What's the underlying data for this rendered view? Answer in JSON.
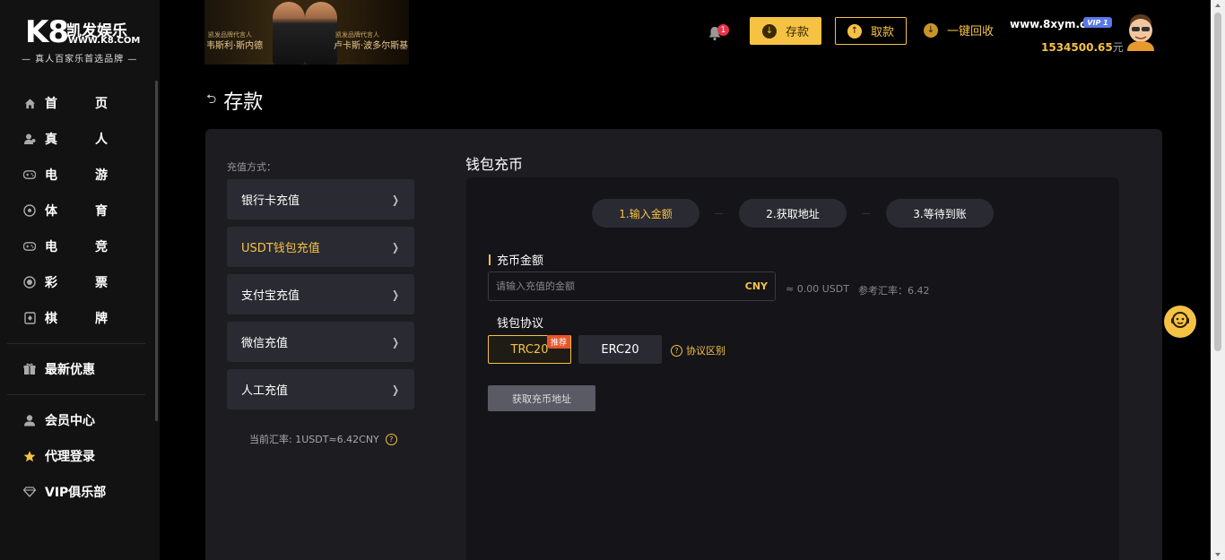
{
  "brand": {
    "logo_mark": "K8",
    "logo_name": "凯发娱乐",
    "logo_url": "WWW.K8.COM",
    "slogan": "— 真人百家乐首选品牌 —"
  },
  "sidebar": {
    "main_items": [
      {
        "label_a": "首",
        "label_b": "页",
        "icon": "home-icon"
      },
      {
        "label_a": "真",
        "label_b": "人",
        "icon": "live-person-icon"
      },
      {
        "label_a": "电",
        "label_b": "游",
        "icon": "gamepad-icon"
      },
      {
        "label_a": "体",
        "label_b": "育",
        "icon": "soccer-ball-icon"
      },
      {
        "label_a": "电",
        "label_b": "竞",
        "icon": "esports-gamepad-icon"
      },
      {
        "label_a": "彩",
        "label_b": "票",
        "icon": "lottery-ball-icon"
      },
      {
        "label_a": "棋",
        "label_b": "牌",
        "icon": "card-icon"
      }
    ],
    "promo": {
      "label": "最新优惠",
      "icon": "gift-icon"
    },
    "bottom_items": [
      {
        "label": "会员中心",
        "icon": "user-icon"
      },
      {
        "label": "代理登录",
        "icon": "star-icon"
      },
      {
        "label": "VIP俱乐部",
        "icon": "diamond-icon"
      }
    ]
  },
  "banner": {
    "ambassador_caption_1": "凯发品牌代言人",
    "ambassador_name_1": "韦斯利·斯内德",
    "ambassador_caption_2": "凯发品牌代言人",
    "ambassador_name_2": "卢卡斯·波多尔斯基"
  },
  "header": {
    "notification_count": "1",
    "deposit_label": "存款",
    "withdraw_label": "取款",
    "recycle_label": "一键回收",
    "username": "www.8xym.cc",
    "vip_label": "VIP 1",
    "balance": "1534500.65",
    "balance_unit": "元"
  },
  "page": {
    "title": "存款"
  },
  "methods": {
    "caption": "充值方式：",
    "items": [
      {
        "label": "银行卡充值",
        "active": false
      },
      {
        "label": "USDT钱包充值",
        "active": true
      },
      {
        "label": "支付宝充值",
        "active": false
      },
      {
        "label": "微信充值",
        "active": false
      },
      {
        "label": "人工充值",
        "active": false
      }
    ],
    "rate_note": "当前汇率: 1USDT≈6.42CNY"
  },
  "wallet": {
    "title": "钱包充币",
    "steps": [
      "1.输入金额",
      "2.获取地址",
      "3.等待到账"
    ],
    "step_separator": "—",
    "amount_label": "充币金额",
    "amount_placeholder": "请输入充值的金额",
    "amount_value": "",
    "amount_unit": "CNY",
    "usdt_approx": "≈ 0.00 USDT",
    "ref_rate": "参考汇率：6.42",
    "protocol_label": "钱包协议",
    "protocols": [
      "TRC20",
      "ERC20"
    ],
    "recommend_badge": "推荐",
    "protocol_diff_label": "协议区别",
    "get_address_label": "获取充币地址"
  },
  "colors": {
    "accent": "#f6c244",
    "background": "#000000",
    "panel": "#1c1c21",
    "badge_red": "#e8334a"
  }
}
